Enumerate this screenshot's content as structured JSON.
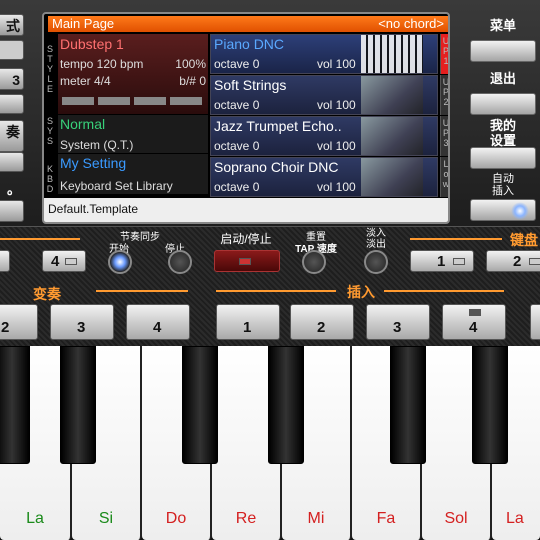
{
  "screen": {
    "title": "Main Page",
    "chord": "<no chord>",
    "footer": "Default.Template",
    "style": {
      "name": "Dubstep 1",
      "tempo": "tempo 120 bpm",
      "pct": "100%",
      "meter": "meter 4/4",
      "key": "b/# 0"
    },
    "sys": {
      "mode": "Normal",
      "label": "System (Q.T.)"
    },
    "kbd": {
      "setting": "My Setting",
      "label": "Keyboard Set Library"
    },
    "side_style": "STYLE",
    "side_sys": "SYS",
    "side_kbd": "KBD",
    "voices": [
      {
        "name": "Piano DNC",
        "octave": "octave 0",
        "vol": "vol 100",
        "tag": "UP1",
        "color": "#e52020"
      },
      {
        "name": "Soft Strings",
        "octave": "octave 0",
        "vol": "vol 100",
        "tag": "UP2",
        "color": "#333333"
      },
      {
        "name": "Jazz Trumpet Echo..",
        "octave": "octave 0",
        "vol": "vol 100",
        "tag": "UP3",
        "color": "#333333"
      },
      {
        "name": "Soprano Choir DNC",
        "octave": "octave 0",
        "vol": "vol 100",
        "tag": "Low",
        "color": "#333333"
      }
    ]
  },
  "left_buttons": [
    "式",
    "3",
    "奏",
    "。"
  ],
  "right": {
    "menu": "菜单",
    "exit": "退出",
    "my_settings": "我的\n设置",
    "auto_insert": "自动\n插入"
  },
  "controls": {
    "sync": "节奏同步",
    "sync_start": "开始",
    "sync_stop": "停止",
    "start_stop": "启动/停止",
    "reset": "重置",
    "tap": "TAP 速度",
    "fade": "淡入\n淡出",
    "keyboard": "键盘",
    "variation": "变奏",
    "insert": "插入",
    "top_buttons": [
      "4",
      "1",
      "2"
    ],
    "var_buttons": [
      "2",
      "3",
      "4"
    ],
    "ins_buttons": [
      "1",
      "2",
      "3",
      "4"
    ]
  },
  "keys": [
    "La",
    "Si",
    "Do",
    "Re",
    "Mi",
    "Fa",
    "Sol",
    "La"
  ],
  "key_colors": [
    "#1a8a1a",
    "#1a8a1a",
    "#d42020",
    "#d42020",
    "#d42020",
    "#d42020",
    "#d42020",
    "#d42020"
  ]
}
